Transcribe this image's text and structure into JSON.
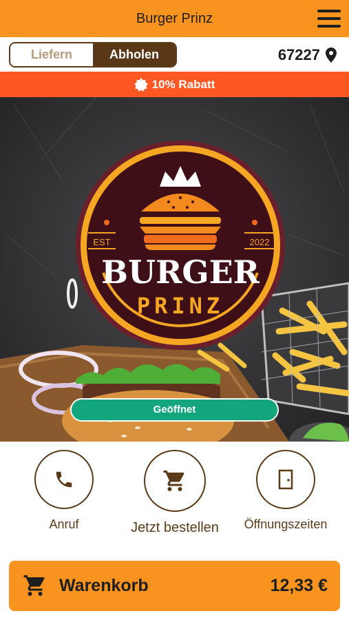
{
  "app": {
    "title": "Burger Prinz"
  },
  "mode_toggle": {
    "options": [
      {
        "label": "Liefern",
        "active": false
      },
      {
        "label": "Abholen",
        "active": true
      }
    ]
  },
  "location": {
    "postal_code": "67227"
  },
  "promo": {
    "text": "10% Rabatt"
  },
  "hero": {
    "logo": {
      "brand_top": "BURGER",
      "brand_bottom": "PRINZ",
      "est_label": "EST",
      "est_year": "2022"
    },
    "status": "Geöffnet"
  },
  "actions": [
    {
      "label": "Anruf",
      "icon": "phone-icon"
    },
    {
      "label": "Jetzt bestellen",
      "icon": "cart-icon"
    },
    {
      "label": "Öffnungszeiten",
      "icon": "door-icon"
    }
  ],
  "cart": {
    "label": "Warenkorb",
    "total": "12,33 €"
  },
  "colors": {
    "primary_orange": "#f7931e",
    "brown": "#5a3817",
    "promo_red": "#fd5723",
    "open_green": "#13a57c"
  }
}
